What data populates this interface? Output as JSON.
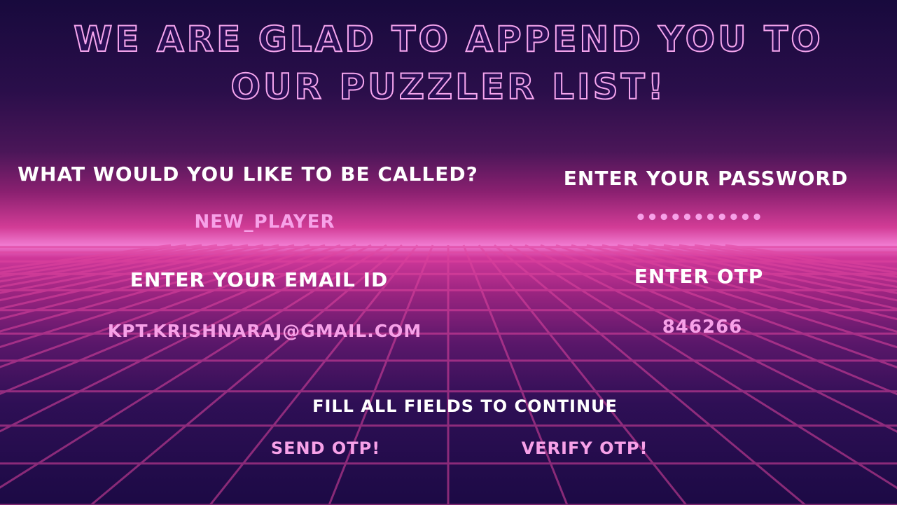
{
  "title": {
    "line1": "We are glad to append you to",
    "line2": "our puzzler list!"
  },
  "fields": {
    "username": {
      "label": "What would you like to be called?",
      "value": "new_player"
    },
    "password": {
      "label": "Enter your password",
      "value": "•••••••••••"
    },
    "email": {
      "label": "Enter your email ID",
      "value": "kpt.krishnaraj@gmail.com"
    },
    "otp": {
      "label": "Enter OTP",
      "value": "846266"
    }
  },
  "status": "Fill all fields to continue",
  "buttons": {
    "send_otp": "Send OTP!",
    "verify_otp": "Verify OTP!"
  },
  "colors": {
    "background_top": "#180a3d",
    "horizon_glow": "#f07ad0",
    "accent_pink": "#f7a1e8",
    "label_white": "#ffffff"
  }
}
